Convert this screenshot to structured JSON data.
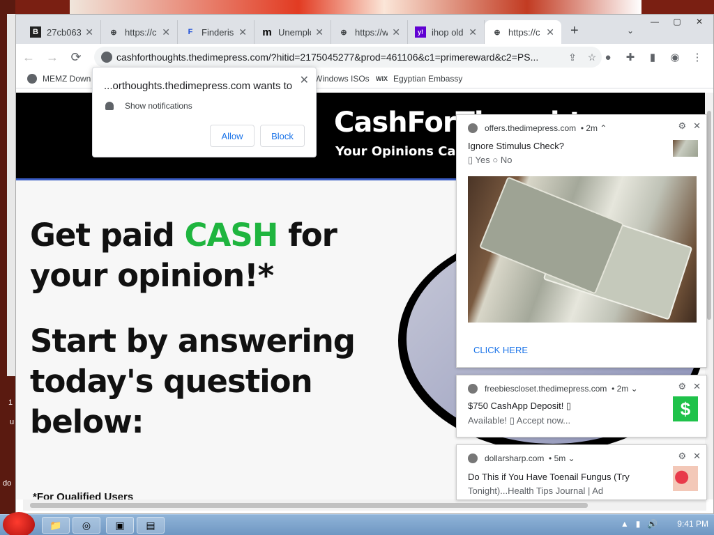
{
  "browser": {
    "tabs": [
      {
        "favicon": "B",
        "title": "27cb063",
        "active": false
      },
      {
        "favicon": "globe-icon",
        "title": "https://c",
        "active": false
      },
      {
        "favicon": "F",
        "title": "Finderish",
        "active": false
      },
      {
        "favicon": "m",
        "title": "Unemplo",
        "active": false
      },
      {
        "favicon": "globe-icon",
        "title": "https://w",
        "active": false
      },
      {
        "favicon": "y!",
        "title": "ihop old",
        "active": false
      },
      {
        "favicon": "globe-icon",
        "title": "https://c",
        "active": true
      }
    ],
    "new_tab": "+",
    "tabs_menu": "⌄",
    "window_controls": {
      "minimize": "—",
      "maximize": "▢",
      "close": "✕"
    },
    "url": "cashforthoughts.thedimepress.com/?hitid=2175045277&prod=461106&c1=primereward&c2=PS...",
    "bookmarks": [
      {
        "icon": "globe-icon",
        "label": "MEMZ Down"
      },
      {
        "icon": "windows-icon",
        "label": "Windows ISOs"
      },
      {
        "icon": "wix-icon",
        "label": "WIX",
        "text": "Egyptian Embassy"
      }
    ]
  },
  "permission_prompt": {
    "title": "...orthoughts.thedimepress.com wants to",
    "row": "Show notifications",
    "allow": "Allow",
    "block": "Block",
    "close": "✕"
  },
  "page": {
    "brand": "CashForThoughts",
    "tagline": "Your Opinions Can",
    "headline_pre": "Get paid ",
    "headline_cash": "CASH",
    "headline_post": " for your opinion!*",
    "subhead": "Start by answering today's question below:",
    "footnote": "*For Qualified Users"
  },
  "notifications": [
    {
      "source": "offers.thedimepress.com",
      "age": "• 2m",
      "title": "Ignore Stimulus Check?",
      "sub": "▯ Yes   ○ No",
      "action": "CLICK HERE"
    },
    {
      "source": "freebiescloset.thedimepress.com",
      "age": "• 2m",
      "title": "$750 CashApp Deposit! ▯",
      "sub": "Available! ▯ Accept now...",
      "thumb": "$"
    },
    {
      "source": "dollarsharp.com",
      "age": "• 5m",
      "title": "Do This if You Have Toenail Fungus (Try",
      "sub": "Tonight)...Health Tips Journal | Ad"
    }
  ],
  "desktop": {
    "left_labels": [
      "1",
      "u",
      "do"
    ]
  },
  "taskbar": {
    "clock": "9:41 PM"
  },
  "colors": {
    "cash_green": "#1fb53f",
    "link_blue": "#1a73e8",
    "cashapp_green": "#1fc24a"
  }
}
